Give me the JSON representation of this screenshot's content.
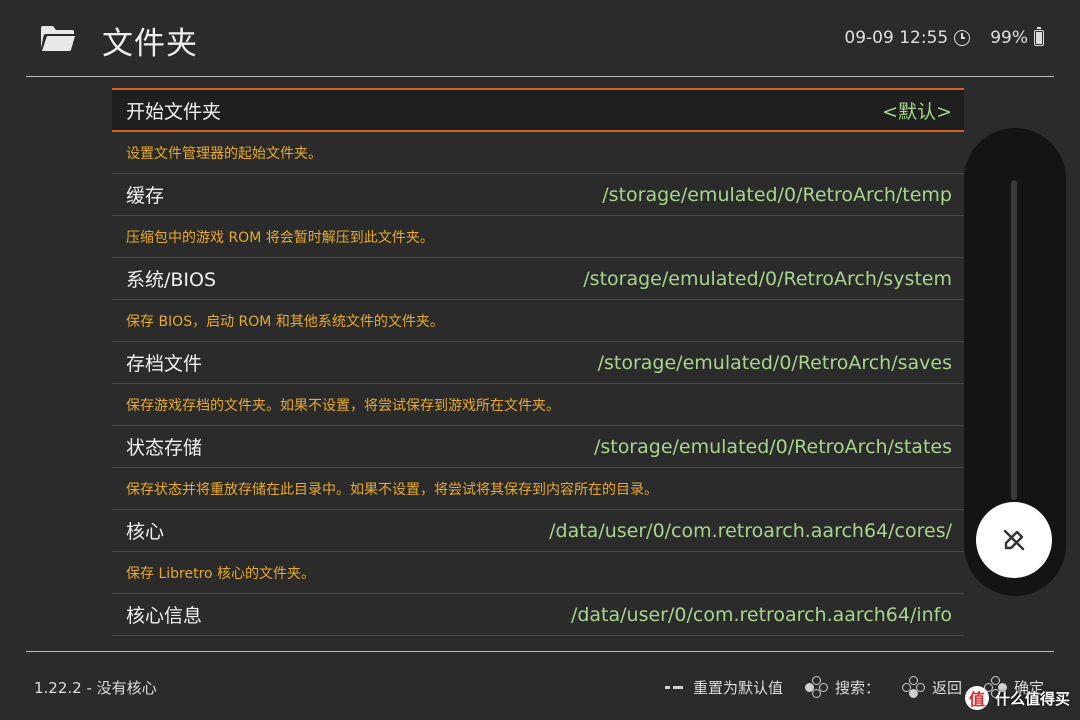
{
  "header": {
    "title": "文件夹",
    "date_time": "09-09 12:55",
    "battery": "99%"
  },
  "items": [
    {
      "label": "开始文件夹",
      "value": "<默认>",
      "desc": "设置文件管理器的起始文件夹。",
      "selected": true
    },
    {
      "label": "缓存",
      "value": "/storage/emulated/0/RetroArch/temp",
      "desc": "压缩包中的游戏 ROM 将会暂时解压到此文件夹。"
    },
    {
      "label": "系统/BIOS",
      "value": "/storage/emulated/0/RetroArch/system",
      "desc": "保存 BIOS，启动 ROM 和其他系统文件的文件夹。"
    },
    {
      "label": "存档文件",
      "value": "/storage/emulated/0/RetroArch/saves",
      "desc": "保存游戏存档的文件夹。如果不设置，将尝试保存到游戏所在文件夹。"
    },
    {
      "label": "状态存储",
      "value": "/storage/emulated/0/RetroArch/states",
      "desc": "保存状态并将重放存储在此目录中。如果不设置，将尝试将其保存到内容所在的目录。"
    },
    {
      "label": "核心",
      "value": "/data/user/0/com.retroarch.aarch64/cores/",
      "desc": "保存 Libretro 核心的文件夹。"
    },
    {
      "label": "核心信息",
      "value": "/data/user/0/com.retroarch.aarch64/info",
      "desc": ""
    }
  ],
  "footer": {
    "version": "1.22.2 - 没有核心",
    "hints": {
      "reset": "重置为默认值",
      "search": "搜索：",
      "back": "返回",
      "ok": "确定"
    }
  },
  "watermark": {
    "badge": "值",
    "text": "什么值得买"
  },
  "colors": {
    "accent_border": "#d2632b",
    "value_text": "#a7d58d",
    "desc_text": "#e7a92f",
    "background": "#2b2b2b"
  },
  "icons": {
    "header": "folder-icon",
    "clock": "clock-icon",
    "battery": "battery-icon",
    "fab": "pen-off-icon"
  }
}
